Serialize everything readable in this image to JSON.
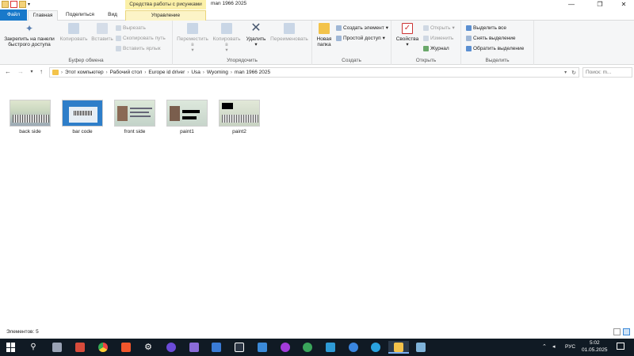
{
  "titlebar": {
    "context_group": "Средства работы с рисунками",
    "title": "man 1966 2025",
    "minimize": "—",
    "maximize": "❐",
    "close": "✕"
  },
  "tabs": {
    "file": "Файл",
    "home": "Главная",
    "share": "Поделиться",
    "view": "Вид",
    "manage": "Управление"
  },
  "ribbon": {
    "clipboard": {
      "label": "Буфер обмена",
      "pin": "Закрепить на панели быстрого доступа",
      "copy": "Копировать",
      "paste": "Вставить",
      "cut": "Вырезать",
      "copy_path": "Скопировать путь",
      "paste_shortcut": "Вставить ярлык"
    },
    "organize": {
      "label": "Упорядочить",
      "move_to": "Переместить в",
      "copy_to": "Копировать в",
      "delete": "Удалить",
      "rename": "Переименовать"
    },
    "create": {
      "label": "Создать",
      "new_folder": "Новая папка",
      "new_item": "Создать элемент",
      "easy_access": "Простой доступ"
    },
    "open": {
      "label": "Открыть",
      "properties": "Свойства",
      "open": "Открыть",
      "edit": "Изменить",
      "history": "Журнал"
    },
    "select": {
      "label": "Выделить",
      "select_all": "Выделить все",
      "select_none": "Снять выделение",
      "invert": "Обратить выделение"
    }
  },
  "nav": {
    "back": "←",
    "forward": "→",
    "up": "↑",
    "breadcrumbs": [
      "Этот компьютер",
      "Рабочий стол",
      "Europe id driver",
      "Usa",
      "Wyoming",
      "man 1966 2025"
    ],
    "search_placeholder": "Поиск: m..."
  },
  "files": [
    {
      "name": "back side"
    },
    {
      "name": "bar code"
    },
    {
      "name": "front side"
    },
    {
      "name": "paint1"
    },
    {
      "name": "paint2"
    }
  ],
  "status": {
    "items_count": "Элементов: 5"
  },
  "taskbar": {
    "language": "РУС",
    "time": "5:02",
    "date": "01.05.2025"
  }
}
